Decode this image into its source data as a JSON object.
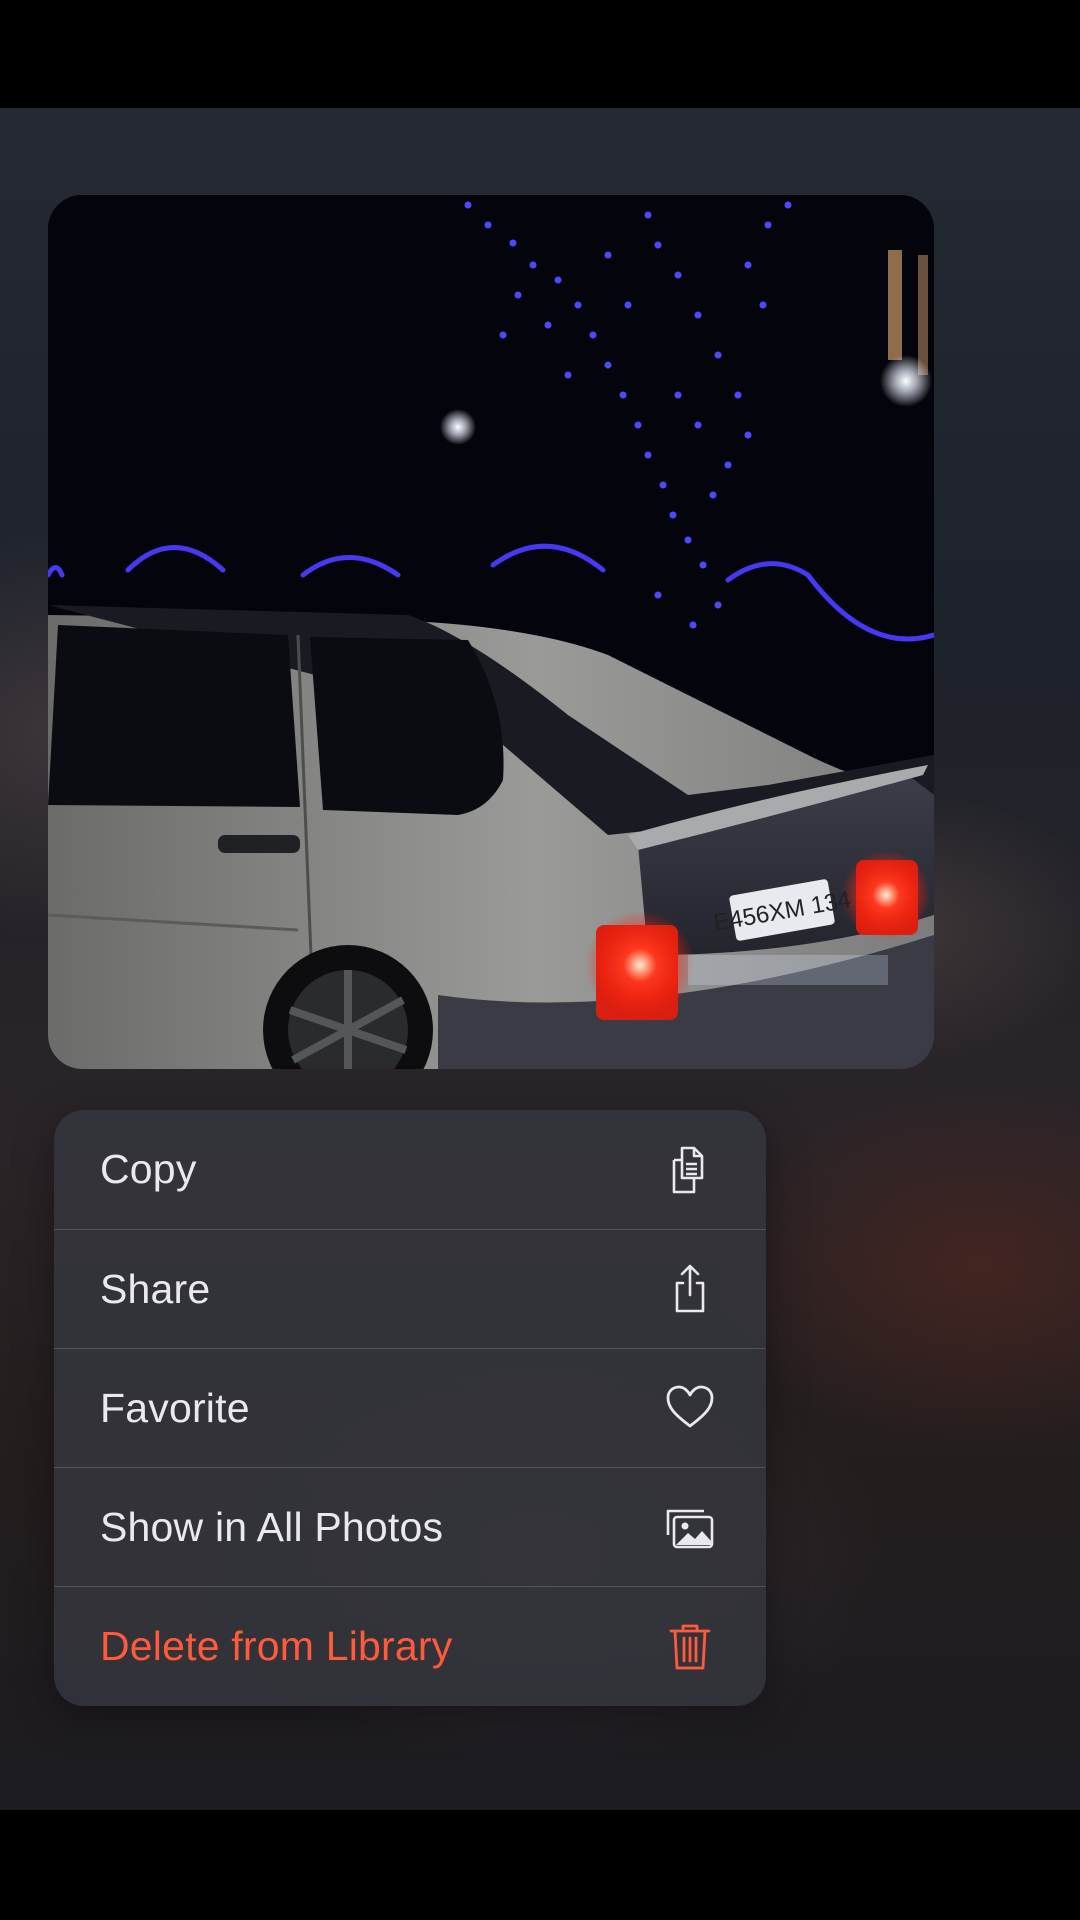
{
  "preview": {
    "image": "photo-preview",
    "plate_text": "E456XM 134"
  },
  "context_menu": {
    "items": [
      {
        "label": "Copy",
        "icon": "copy-icon",
        "destructive": false
      },
      {
        "label": "Share",
        "icon": "share-icon",
        "destructive": false
      },
      {
        "label": "Favorite",
        "icon": "heart-icon",
        "destructive": false
      },
      {
        "label": "Show in All Photos",
        "icon": "photos-icon",
        "destructive": false
      },
      {
        "label": "Delete from Library",
        "icon": "trash-icon",
        "destructive": true
      }
    ]
  },
  "colors": {
    "destructive": "#ff5a3c",
    "menu_text": "#e9e9ee",
    "neon_lights": "#3d3dff",
    "tail_light": "#ff2a1a"
  }
}
